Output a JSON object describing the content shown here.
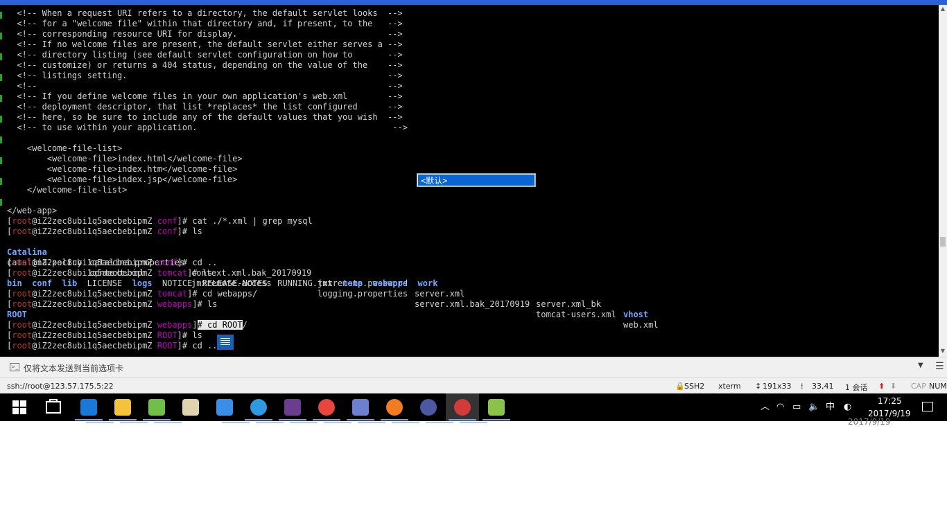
{
  "terminal": {
    "lines": [
      "  <!-- When a request URI refers to a directory, the default servlet looks  -->",
      "  <!-- for a \"welcome file\" within that directory and, if present, to the   -->",
      "  <!-- corresponding resource URI for display.                              -->",
      "  <!-- If no welcome files are present, the default servlet either serves a -->",
      "  <!-- directory listing (see default servlet configuration on how to       -->",
      "  <!-- customize) or returns a 404 status, depending on the value of the    -->",
      "  <!-- listings setting.                                                    -->",
      "  <!--                                                                      -->",
      "  <!-- If you define welcome files in your own application's web.xml        -->",
      "  <!-- deployment descriptor, that list *replaces* the list configured      -->",
      "  <!-- here, so be sure to include any of the default values that you wish  -->",
      "  <!-- to use within your application.                                       -->",
      "",
      "    <welcome-file-list>",
      "        <welcome-file>index.html</welcome-file>",
      "        <welcome-file>index.htm</welcome-file>",
      "        <welcome-file>index.jsp</welcome-file>",
      "    </welcome-file-list>",
      "",
      "</web-app>"
    ],
    "prompt_user": "root",
    "prompt_host": "@iZ2zec8ubi1q5aecbebipmZ",
    "sessions": [
      {
        "dir": "conf",
        "cmd": "# cat ./*.xml | grep mysql"
      },
      {
        "dir": "conf",
        "cmd": "# ls"
      },
      {
        "dir": "conf",
        "cmd": "# cd .."
      },
      {
        "dir": "tomcat",
        "cmd": "# ls"
      },
      {
        "dir": "tomcat",
        "cmd": "# cd webapps/"
      },
      {
        "dir": "webapps",
        "cmd": "# ls"
      },
      {
        "dir": "webapps",
        "cmd": "# cd ROOT",
        "tail": "/"
      },
      {
        "dir": "ROOT",
        "cmd": "# ls"
      },
      {
        "dir": "ROOT",
        "cmd": "# cd .."
      }
    ],
    "ls_conf": {
      "row1": [
        "Catalina",
        "catalina.properties",
        "context.xml.bak_20170919",
        "jmxremote.password",
        "server.xml",
        "server.xml_bk",
        "vhost"
      ],
      "row2": [
        "catalina.policy",
        "context.xml",
        "jmxremote.access",
        "logging.properties",
        "server.xml.bak_20170919",
        "tomcat-users.xml",
        "web.xml"
      ]
    },
    "ls_tomcat": [
      "bin",
      "conf",
      "lib",
      "LICENSE",
      "logs",
      "NOTICE",
      "RELEASE-NOTES",
      "RUNNING.txt",
      "temp",
      "webapps",
      "work"
    ],
    "ls_webapps": "ROOT",
    "ime_popup": "<默认>"
  },
  "compose_bar": {
    "placeholder": "仅将文本发送到当前选项卡"
  },
  "status_bar": {
    "address": "ssh://root@123.57.175.5:22",
    "protocol": "SSH2",
    "terminal_type": "xterm",
    "size": "191x33",
    "cursor_pos": "33,41",
    "sessions": "1 会话",
    "caps": "CAP",
    "num": "NUM"
  },
  "taskbar": {
    "apps": [
      {
        "name": "edge",
        "color": "#1a78d8"
      },
      {
        "name": "file-explorer",
        "color": "#f3c33b"
      },
      {
        "name": "notepad-plus",
        "color": "#6fbf4a"
      },
      {
        "name": "paint",
        "color": "#e0d4b0"
      },
      {
        "name": "baidu-netdisk",
        "color": "#3a8ee6"
      },
      {
        "name": "ie",
        "color": "#2d9ae0"
      },
      {
        "name": "game",
        "color": "#6a3d8f"
      },
      {
        "name": "chrome",
        "color": "#e8453c"
      },
      {
        "name": "mysql-dolphin",
        "color": "#6f7fd0"
      },
      {
        "name": "firefox",
        "color": "#f47c20"
      },
      {
        "name": "eclipse",
        "color": "#4b5aa0"
      },
      {
        "name": "xshell",
        "color": "#d33a3a"
      },
      {
        "name": "xftp",
        "color": "#8bc34a"
      }
    ],
    "ime": "中",
    "time": "17:25",
    "date": "2017/9/19"
  }
}
